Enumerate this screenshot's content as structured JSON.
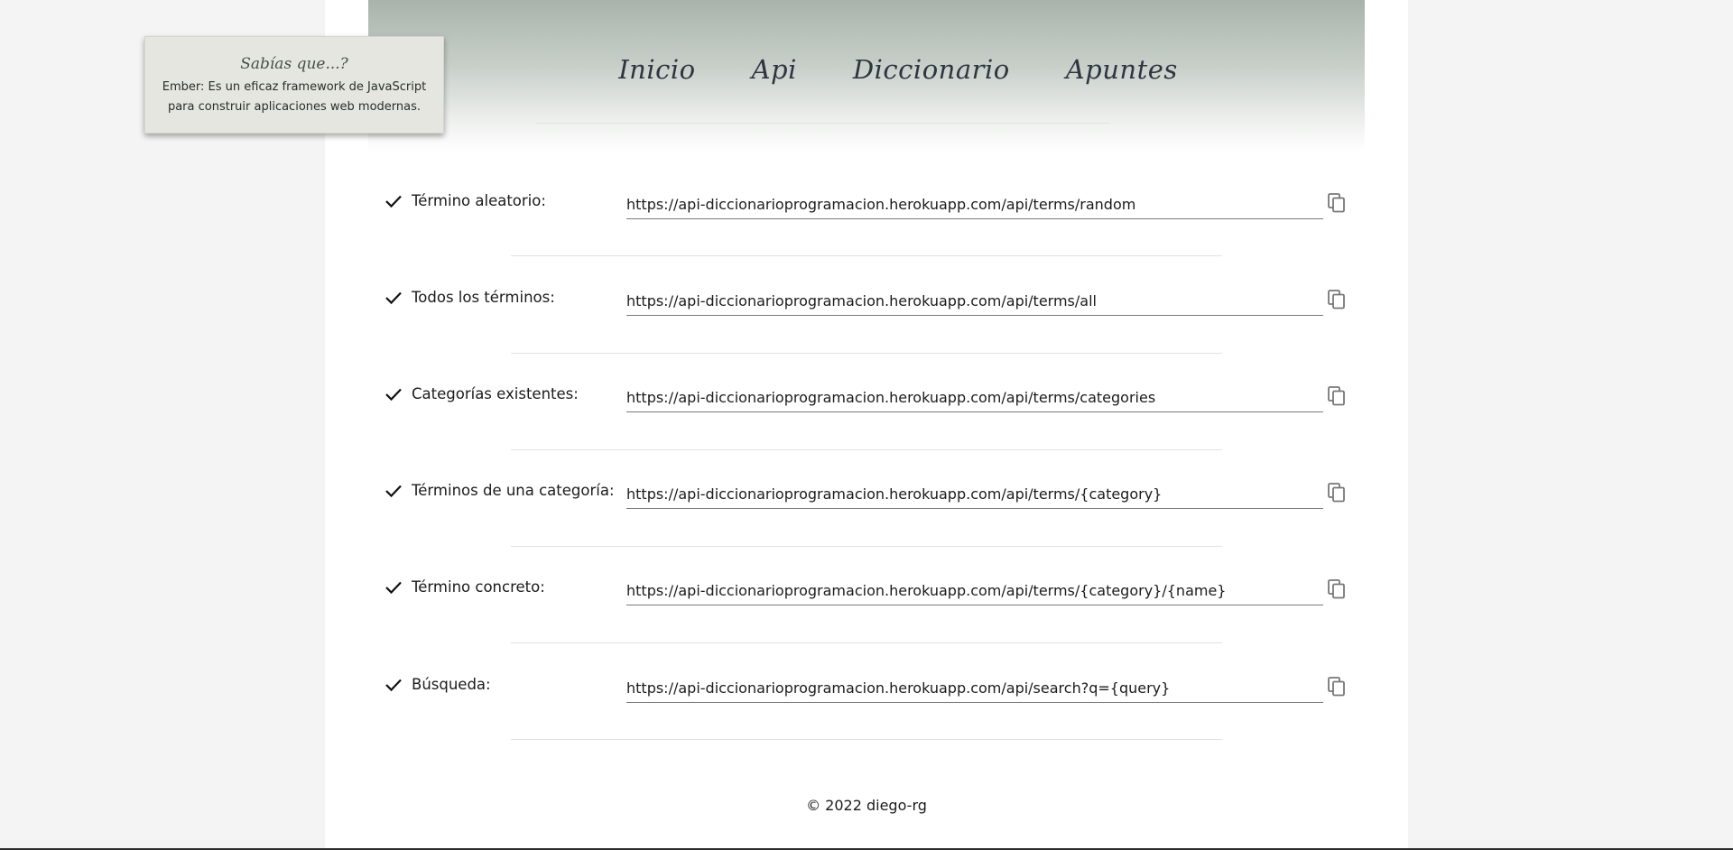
{
  "nav": {
    "items": [
      {
        "label": "Inicio"
      },
      {
        "label": "Api"
      },
      {
        "label": "Diccionario"
      },
      {
        "label": "Apuntes"
      }
    ]
  },
  "tip": {
    "title": "Sabías que...?",
    "text": "Ember: Es un eficaz framework de JavaScript para construir aplicaciones web modernas."
  },
  "endpoints": [
    {
      "label": "Término aleatorio:",
      "url": "https://api-diccionarioprogramacion.herokuapp.com/api/terms/random",
      "icon": "check-icon",
      "action_icon": "copy-icon"
    },
    {
      "label": "Todos los términos:",
      "url": "https://api-diccionarioprogramacion.herokuapp.com/api/terms/all",
      "icon": "check-icon",
      "action_icon": "copy-icon"
    },
    {
      "label": "Categorías existentes:",
      "url": "https://api-diccionarioprogramacion.herokuapp.com/api/terms/categories",
      "icon": "check-icon",
      "action_icon": "copy-icon"
    },
    {
      "label": "Términos de una categoría:",
      "url": "https://api-diccionarioprogramacion.herokuapp.com/api/terms/{category}",
      "icon": "check-icon",
      "action_icon": "copy-icon"
    },
    {
      "label": "Término concreto:",
      "url": "https://api-diccionarioprogramacion.herokuapp.com/api/terms/{category}/{name}",
      "icon": "check-icon",
      "action_icon": "copy-icon"
    },
    {
      "label": "Búsqueda:",
      "url": "https://api-diccionarioprogramacion.herokuapp.com/api/search?q={query}",
      "icon": "check-icon",
      "action_icon": "copy-icon"
    }
  ],
  "footer": {
    "text": "© 2022 diego-rg"
  },
  "colors": {
    "header_gradient_top": "#a9b3ab",
    "tip_background": "#e4e6df",
    "page_background": "#f4f4f4",
    "content_background": "#ffffff"
  }
}
